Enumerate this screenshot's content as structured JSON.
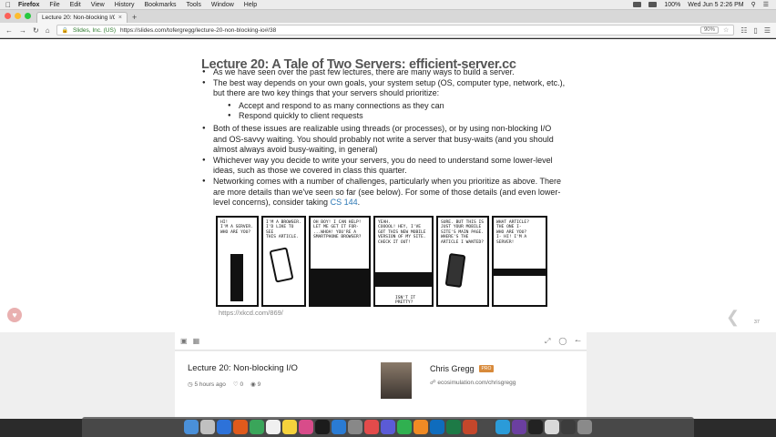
{
  "menubar": {
    "app": "Firefox",
    "menus": [
      "Firefox",
      "File",
      "Edit",
      "View",
      "History",
      "Bookmarks",
      "Tools",
      "Window",
      "Help"
    ],
    "battery": "100%",
    "datetime": "Wed Jun 5  2:26 PM"
  },
  "browser": {
    "tab_title": "Lecture 20: Non-blocking I/O",
    "identity": "Slides, Inc. (US)",
    "url": "https://slides.com/tofergregg/lecture-20-non-blocking-io#/38",
    "zoom": "90%"
  },
  "slide": {
    "title": "Lecture 20: A Tale of Two Servers: efficient-server.cc",
    "bullets": [
      "As we have seen over the past few lectures, there are many ways to build a server.",
      "The best way depends on your own goals, your system setup (OS, computer type, network, etc.), but there are two key things that your servers should prioritize:",
      "Both of these issues are realizable using threads (or processes), or by using non-blocking I/O and OS-savvy waiting. You should probably not write a server that busy-waits (and you should almost always avoid busy-waiting, in general)",
      "Whichever way you decide to write your servers, you do need to understand some lower-level ideas, such as those we covered in class this quarter.",
      "Networking comes with a number of challenges, particularly when you prioritize as above. There are more details than we've seen so far (see below). For some of those details (and even lower-level concerns), consider taking"
    ],
    "subbullets": [
      "Accept and respond to as many connections as they can",
      "Respond quickly to client requests"
    ],
    "course_link": "CS 144",
    "link_suffix": ".",
    "comic_panels": [
      "HI!\nI'M A SERVER.\nWHO ARE YOU?",
      "I'M A BROWSER.\nI'D LIKE TO SEE\nTHIS ARTICLE.",
      "OH BOY! I CAN HELP!\nLET ME GET IT FOR-\n...WHOA! YOU'RE A\nSMARTPHONE BROWSER?",
      "YEAH.\nCOOOOL! HEY, I'VE\nGOT THIS NEW MOBILE\nVERSION OF MY SITE.\nCHECK IT OUT!",
      "SURE. BUT THIS IS\nJUST YOUR MOBILE\nSITE'S MAIN PAGE.\nWHERE'S THE\nARTICLE I WANTED?",
      "WHAT ARTICLE?\nTHE ONE I-\nWHO ARE YOU?\nI-  HI! I'M A SERVER!"
    ],
    "comic_extra": "ISN'T IT PRETTY?",
    "comic_caption": "https://xkcd.com/869/",
    "page_number": "37"
  },
  "deck": {
    "title": "Lecture 20: Non-blocking I/O",
    "time": "5 hours ago",
    "likes": "0",
    "views": "9",
    "author": "Chris Gregg",
    "badge": "PRO",
    "author_site": "ecosimulation.com/chrisgregg"
  },
  "colors": {
    "accent": "#2b77b5",
    "title": "#555555",
    "dock": "#505050"
  }
}
